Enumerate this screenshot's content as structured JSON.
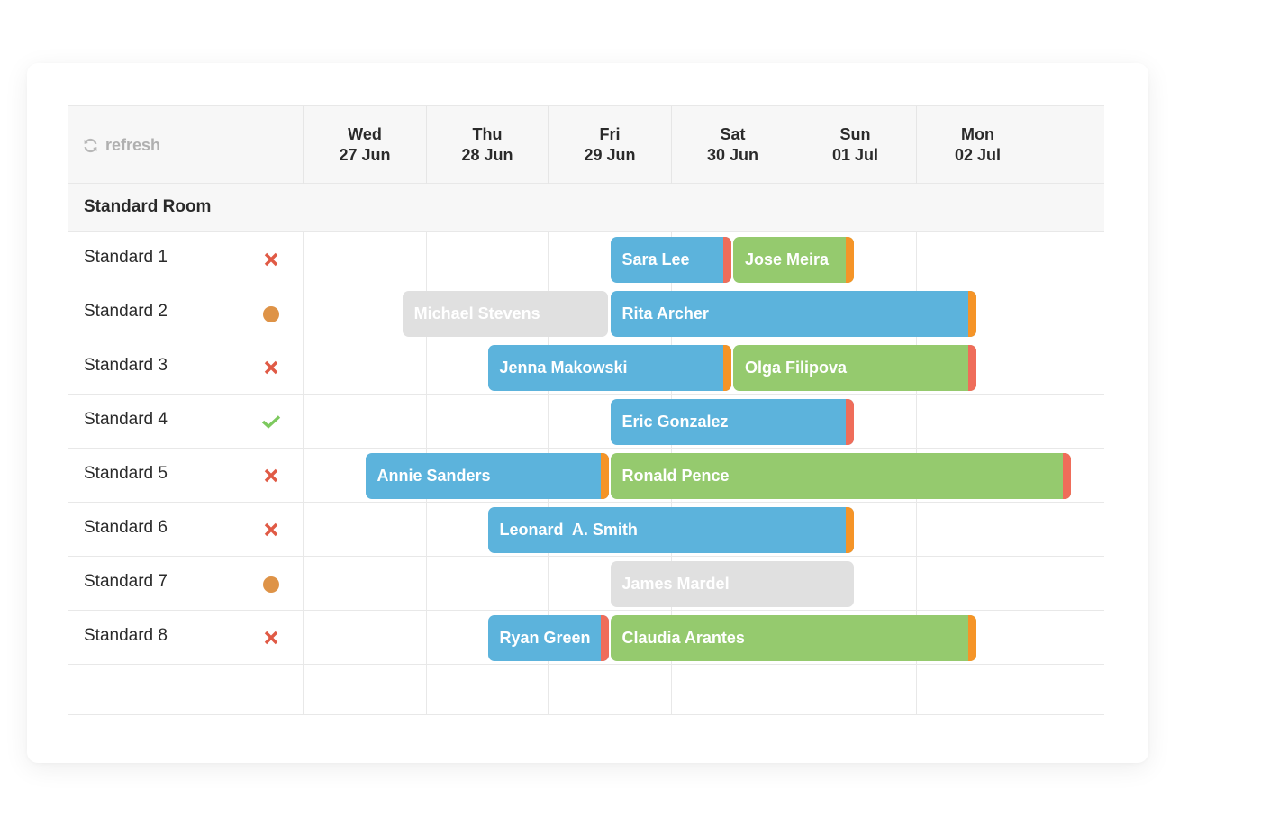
{
  "toolbar": {
    "refresh_label": "refresh",
    "refresh_icon": "refresh-icon"
  },
  "days": [
    {
      "dow": "Wed",
      "date": "27 Jun"
    },
    {
      "dow": "Thu",
      "date": "28 Jun"
    },
    {
      "dow": "Fri",
      "date": "29 Jun"
    },
    {
      "dow": "Sat",
      "date": "30 Jun"
    },
    {
      "dow": "Sun",
      "date": "01 Jul"
    },
    {
      "dow": "Mon",
      "date": "02 Jul"
    },
    {
      "dow": "",
      "date": ""
    }
  ],
  "group": {
    "name": "Standard Room"
  },
  "rooms": [
    {
      "name": "Standard 1",
      "status": "dirty",
      "status_icon": "cross-icon"
    },
    {
      "name": "Standard 2",
      "status": "cleanup",
      "status_icon": "dot-icon"
    },
    {
      "name": "Standard 3",
      "status": "dirty",
      "status_icon": "cross-icon"
    },
    {
      "name": "Standard 4",
      "status": "clean",
      "status_icon": "check-icon"
    },
    {
      "name": "Standard 5",
      "status": "dirty",
      "status_icon": "cross-icon"
    },
    {
      "name": "Standard 6",
      "status": "dirty",
      "status_icon": "cross-icon"
    },
    {
      "name": "Standard 7",
      "status": "cleanup",
      "status_icon": "dot-icon"
    },
    {
      "name": "Standard 8",
      "status": "dirty",
      "status_icon": "cross-icon"
    }
  ],
  "status_colors": {
    "dirty": "#e05a45",
    "cleanup": "#de9347",
    "clean": "#7dc95e"
  },
  "event_colors": {
    "blue": "#5cb3dc",
    "green": "#95ca6e",
    "gray": "#e0e0e0",
    "tag_red": "#ef6d5a",
    "tag_orange": "#f59427"
  },
  "events": [
    {
      "room": 0,
      "guest": "Sara Lee",
      "start_day": 2.5,
      "end_day": 3.5,
      "color": "blue",
      "tag": "red"
    },
    {
      "room": 0,
      "guest": "Jose Meira",
      "start_day": 3.5,
      "end_day": 4.5,
      "color": "green",
      "tag": "orange"
    },
    {
      "room": 1,
      "guest": "Michael Stevens",
      "start_day": 0.8,
      "end_day": 2.5,
      "color": "gray",
      "tag": null
    },
    {
      "room": 1,
      "guest": "Rita Archer",
      "start_day": 2.5,
      "end_day": 5.5,
      "color": "blue",
      "tag": "orange"
    },
    {
      "room": 2,
      "guest": "Jenna Makowski",
      "start_day": 1.5,
      "end_day": 3.5,
      "color": "blue",
      "tag": "orange"
    },
    {
      "room": 2,
      "guest": "Olga Filipova",
      "start_day": 3.5,
      "end_day": 5.5,
      "color": "green",
      "tag": "red"
    },
    {
      "room": 3,
      "guest": "Eric Gonzalez",
      "start_day": 2.5,
      "end_day": 4.5,
      "color": "blue",
      "tag": "red"
    },
    {
      "room": 4,
      "guest": "Annie Sanders",
      "start_day": 0.5,
      "end_day": 2.5,
      "color": "blue",
      "tag": "orange"
    },
    {
      "room": 4,
      "guest": "Ronald Pence",
      "start_day": 2.5,
      "end_day": 6.5,
      "color": "green",
      "tag": "red"
    },
    {
      "room": 5,
      "guest": "Leonard  A. Smith",
      "start_day": 1.5,
      "end_day": 4.5,
      "color": "blue",
      "tag": "orange"
    },
    {
      "room": 6,
      "guest": "James Mardel",
      "start_day": 2.5,
      "end_day": 4.5,
      "color": "gray",
      "tag": null
    },
    {
      "room": 7,
      "guest": "Ryan Green",
      "start_day": 1.5,
      "end_day": 2.5,
      "color": "blue",
      "tag": "red"
    },
    {
      "room": 7,
      "guest": "Claudia Arantes",
      "start_day": 2.5,
      "end_day": 5.5,
      "color": "green",
      "tag": "orange"
    }
  ]
}
